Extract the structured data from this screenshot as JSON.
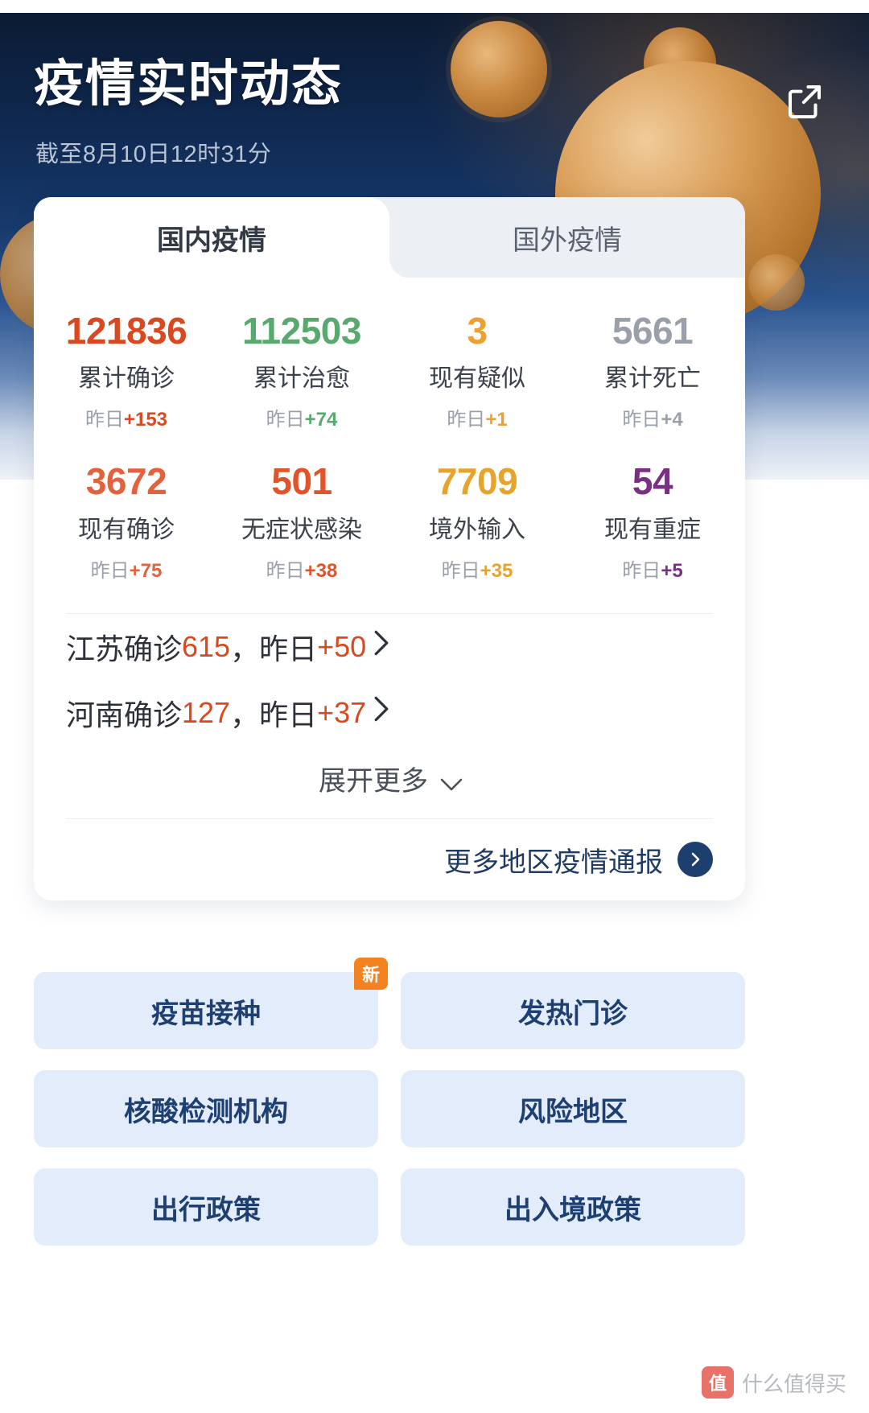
{
  "header": {
    "title": "疫情实时动态",
    "subtitle": "截至8月10日12时31分",
    "share_icon": "share-external-icon"
  },
  "tabs": [
    {
      "label": "国内疫情",
      "active": true
    },
    {
      "label": "国外疫情",
      "active": false
    }
  ],
  "stats": [
    {
      "value": "121836",
      "label": "累计确诊",
      "delta_prefix": "昨日",
      "delta": "+153",
      "color": "#d9481e"
    },
    {
      "value": "112503",
      "label": "累计治愈",
      "delta_prefix": "昨日",
      "delta": "+74",
      "color": "#57a96e"
    },
    {
      "value": "3",
      "label": "现有疑似",
      "delta_prefix": "昨日",
      "delta": "+1",
      "color": "#eda030"
    },
    {
      "value": "5661",
      "label": "累计死亡",
      "delta_prefix": "昨日",
      "delta": "+4",
      "color": "#9aa0a9"
    },
    {
      "value": "3672",
      "label": "现有确诊",
      "delta_prefix": "昨日",
      "delta": "+75",
      "color": "#e4613d"
    },
    {
      "value": "501",
      "label": "无症状感染",
      "delta_prefix": "昨日",
      "delta": "+38",
      "color": "#e2532a"
    },
    {
      "value": "7709",
      "label": "境外输入",
      "delta_prefix": "昨日",
      "delta": "+35",
      "color": "#e7a42c"
    },
    {
      "value": "54",
      "label": "现有重症",
      "delta_prefix": "昨日",
      "delta": "+5",
      "color": "#7b2f84"
    }
  ],
  "provinces": [
    {
      "name": "江苏确诊",
      "count": "615",
      "sep": "，",
      "delta_prefix": "昨日",
      "delta": "+50",
      "chevron": "chevron-right-icon"
    },
    {
      "name": "河南确诊",
      "count": "127",
      "sep": "，",
      "delta_prefix": "昨日",
      "delta": "+37",
      "chevron": "chevron-right-icon"
    }
  ],
  "expand": {
    "label": "展开更多",
    "icon": "chevron-down-icon"
  },
  "more_link": {
    "label": "更多地区疫情通报",
    "icon": "arrow-right-circle-icon"
  },
  "actions": [
    {
      "label": "疫苗接种",
      "badge": "新"
    },
    {
      "label": "发热门诊",
      "badge": ""
    },
    {
      "label": "核酸检测机构",
      "badge": ""
    },
    {
      "label": "风险地区",
      "badge": ""
    },
    {
      "label": "出行政策",
      "badge": ""
    },
    {
      "label": "出入境政策",
      "badge": ""
    }
  ],
  "watermark": {
    "mark": "值",
    "text": "什么值得买"
  },
  "colors": {
    "accent_red": "#d9481e",
    "accent_green": "#57a96e",
    "accent_orange": "#eda030",
    "accent_gray": "#9aa0a9",
    "accent_purple": "#7b2f84",
    "brand_navy": "#1e3f72",
    "badge_orange": "#f58220"
  }
}
